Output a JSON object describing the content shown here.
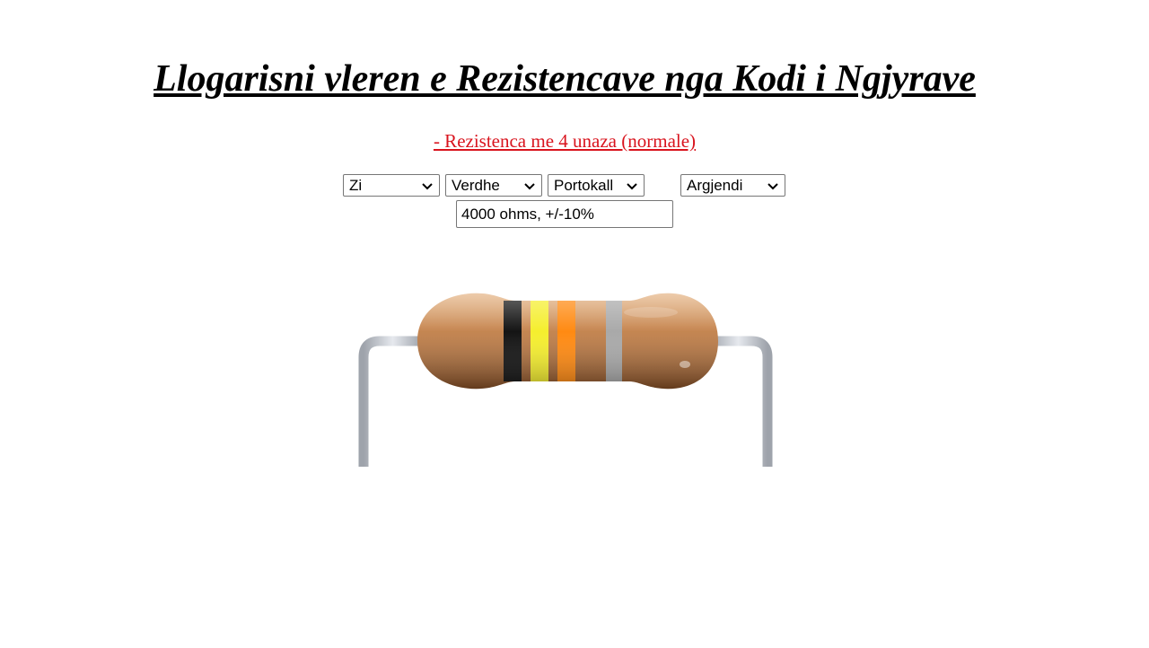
{
  "page": {
    "title": "Llogarisni vleren e Rezistencave nga Kodi i Ngjyrave",
    "subtitle_link": "- Rezistenca me 4 unaza (normale)"
  },
  "bands": {
    "band1": {
      "selected": "Zi"
    },
    "band2": {
      "selected": "Verdhe"
    },
    "multiplier": {
      "selected": "Portokall"
    },
    "tolerance": {
      "selected": "Argjendi"
    }
  },
  "result": {
    "value": "4000 ohms, +/-10%"
  },
  "resistor": {
    "band_colors": [
      "#141414",
      "#f5ee2e",
      "#ff8a12",
      "#a9a9a9"
    ],
    "body_color": "#c98a55",
    "lead_color": "#b9bec6"
  }
}
